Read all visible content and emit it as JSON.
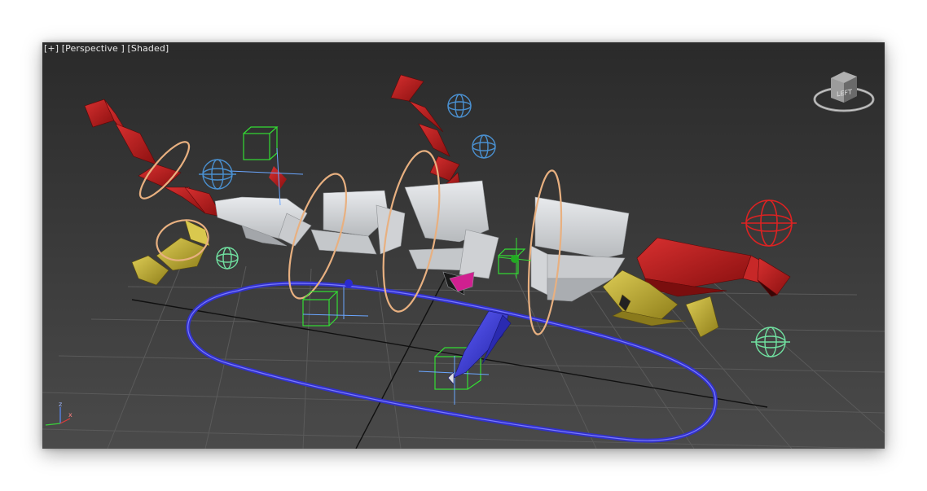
{
  "viewport": {
    "label_plus": "[+]",
    "label_view": "[Perspective ]",
    "label_shading": "[Shaded]",
    "viewcube_face": "LEFT",
    "axis_z": "z",
    "axis_x": "x"
  },
  "colors": {
    "grid": "#5a5a5a",
    "grid_major": "#0d0d0d",
    "red_pyramid": "#b62020",
    "yellow_object": "#c8b43c",
    "white_mesh": "#d6d8db",
    "blue_path": "#3a3ad0",
    "orange_ring": "#e8b080",
    "green_helper": "#33dd33",
    "blue_sphere_gizmo": "#4a90d0",
    "red_sphere_gizmo": "#dd2222",
    "mint_sphere_gizmo": "#70e0a0",
    "magenta": "#d02090"
  },
  "icons": [
    "viewcube-icon",
    "axis-tripod-icon"
  ]
}
